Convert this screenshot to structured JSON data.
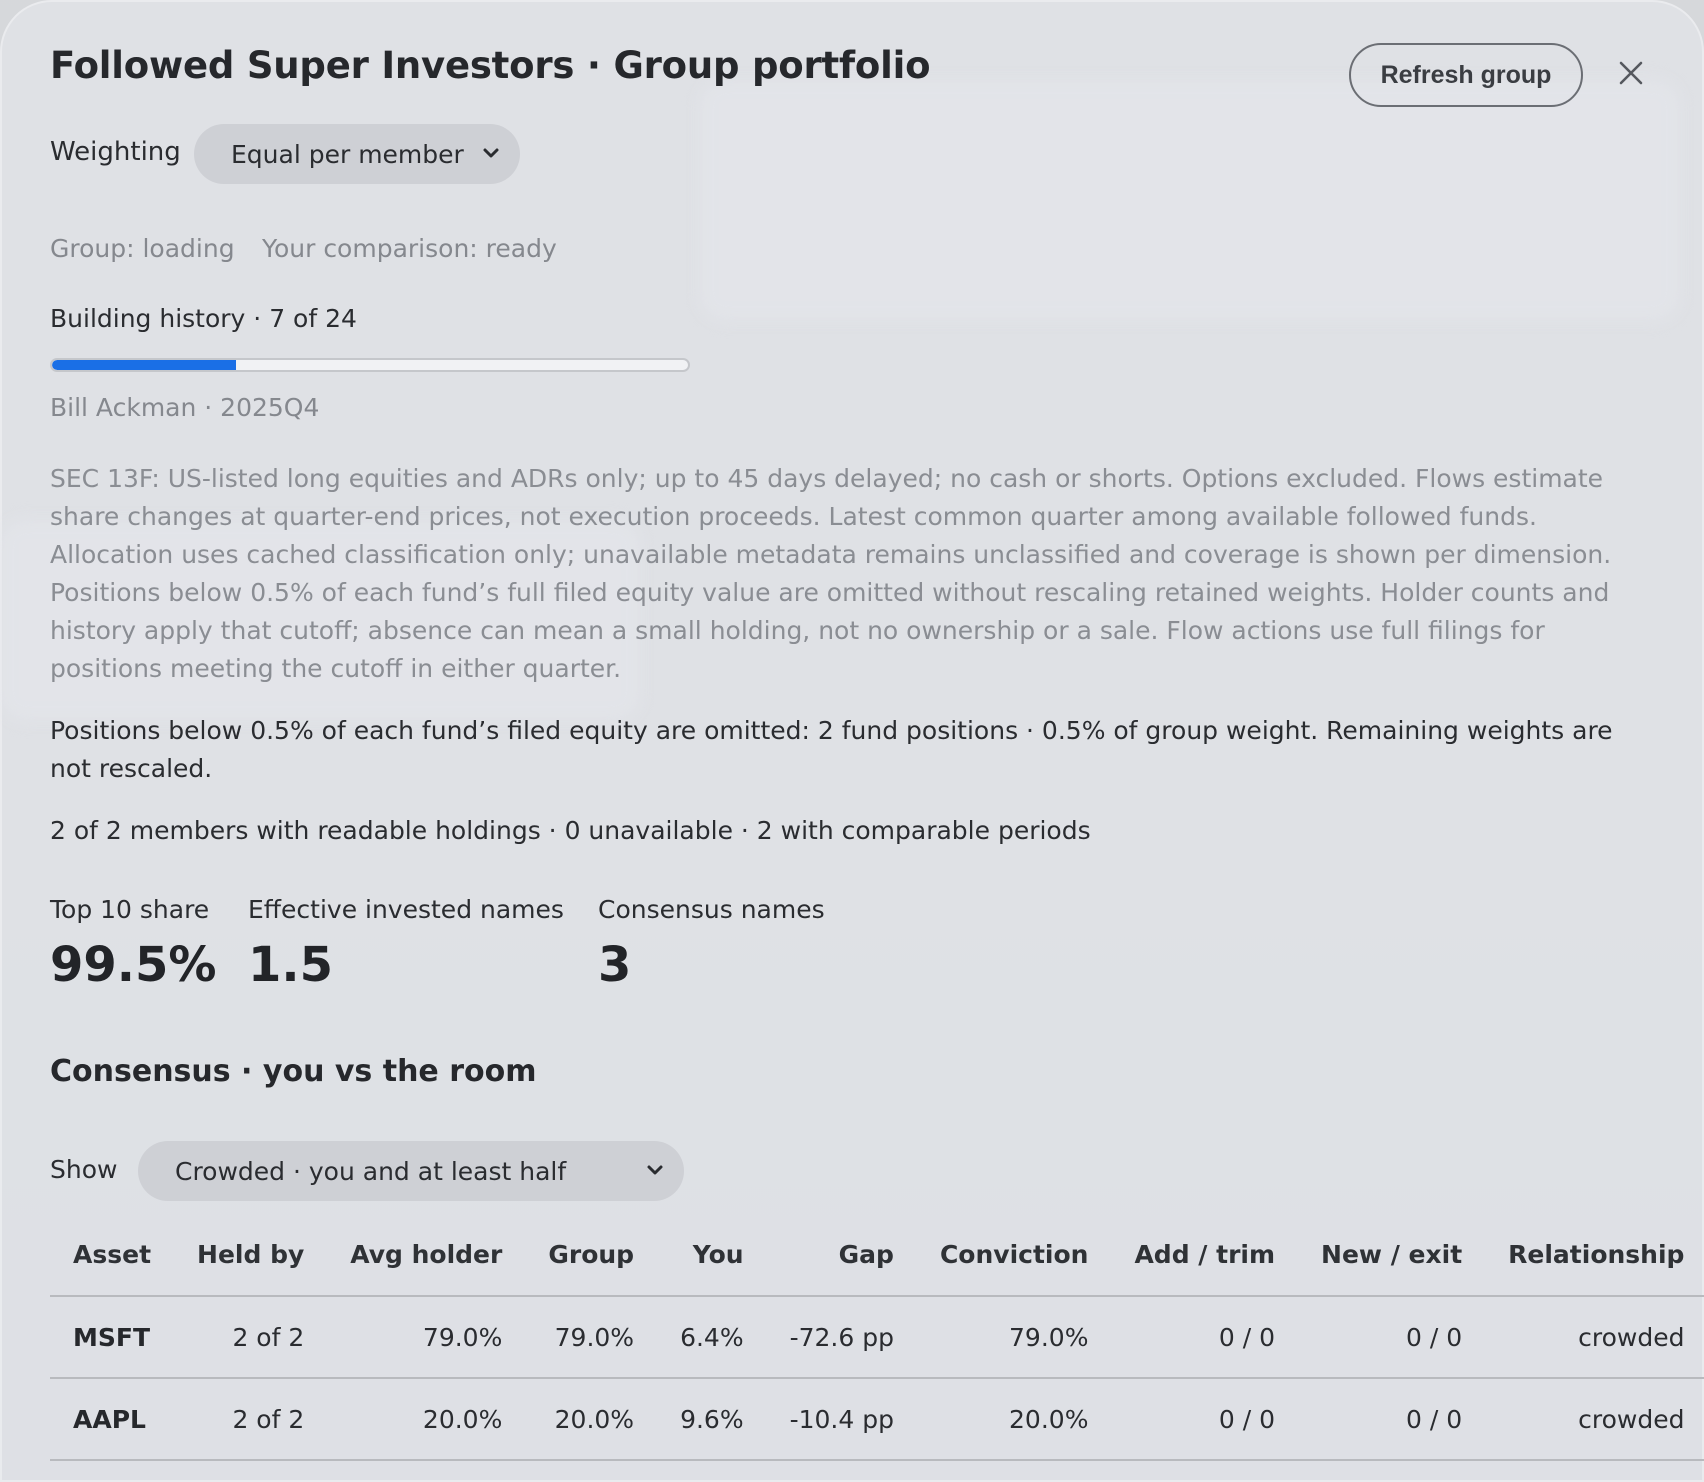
{
  "header": {
    "title": "Followed Super Investors · Group portfolio",
    "refresh_label": "Refresh group"
  },
  "weighting": {
    "label": "Weighting",
    "selected": "Equal per member"
  },
  "status": {
    "group": "Group: loading",
    "comparison": "Your comparison: ready"
  },
  "history": {
    "label": "Building history · 7 of 24",
    "progress_fraction": 0.29,
    "current": "Bill Ackman · 2025Q4"
  },
  "disclaimer": "SEC 13F: US-listed long equities and ADRs only; up to 45 days delayed; no cash or shorts. Options excluded. Flows estimate share changes at quarter-end prices, not execution proceeds. Latest common quarter among available followed funds. Allocation uses cached classification only; unavailable metadata remains unclassified and coverage is shown per dimension. Positions below 0.5% of each fund’s full filed equity value are omitted without rescaling retained weights. Holder counts and history apply that cutoff; absence can mean a small holding, not no ownership or a sale. Flow actions use full filings for positions meeting the cutoff in either quarter.",
  "cutoff_note": "Positions below 0.5% of each fund’s filed equity are omitted: 2 fund positions · 0.5% of group weight. Remaining weights are not rescaled.",
  "members_note": "2 of 2 members with readable holdings · 0 unavailable · 2 with comparable periods",
  "stats": [
    {
      "label": "Top 10 share",
      "value": "99.5%"
    },
    {
      "label": "Effective invested names",
      "value": "1.5"
    },
    {
      "label": "Consensus names",
      "value": "3"
    }
  ],
  "consensus": {
    "title": "Consensus · you vs the room",
    "show_label": "Show",
    "show_selected": "Crowded · you and at least half",
    "columns": [
      "Asset",
      "Held by",
      "Avg holder",
      "Group",
      "You",
      "Gap",
      "Conviction",
      "Add / trim",
      "New / exit",
      "Relationship"
    ],
    "rows": [
      [
        "MSFT",
        "2 of 2",
        "79.0%",
        "79.0%",
        "6.4%",
        "-72.6 pp",
        "79.0%",
        "0 / 0",
        "0 / 0",
        "crowded"
      ],
      [
        "AAPL",
        "2 of 2",
        "20.0%",
        "20.0%",
        "9.6%",
        "-10.4 pp",
        "20.0%",
        "0 / 0",
        "0 / 0",
        "crowded"
      ]
    ]
  },
  "colors": {
    "accent": "#1a6fe6",
    "panel": "#e0e2e6"
  }
}
